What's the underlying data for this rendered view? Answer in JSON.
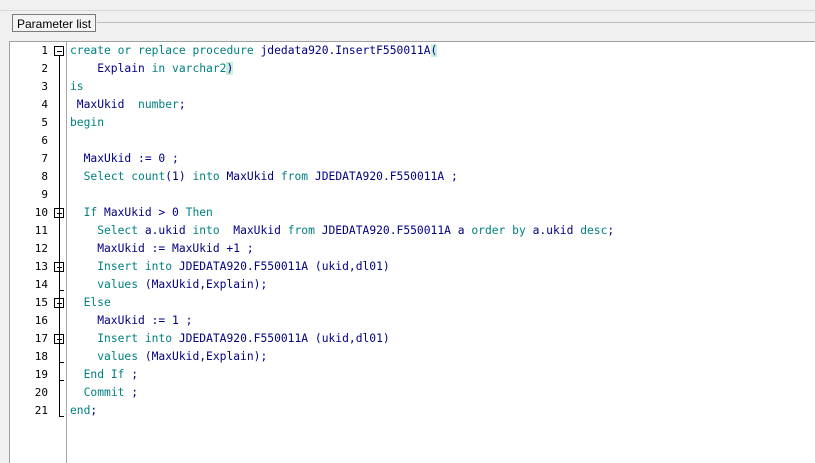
{
  "toolbar": {
    "parameter_list_label": "Parameter list"
  },
  "colors": {
    "keyword": "#008080",
    "identifier": "#000080",
    "background": "#ffffff",
    "gutter_border": "#a8a8a8"
  },
  "editor": {
    "lines": [
      {
        "number": "1",
        "text": "create or replace procedure jdedata920.InsertF550011A("
      },
      {
        "number": "2",
        "text": "    Explain in varchar2)"
      },
      {
        "number": "3",
        "text": "is"
      },
      {
        "number": "4",
        "text": " MaxUkid  number;"
      },
      {
        "number": "5",
        "text": "begin"
      },
      {
        "number": "6",
        "text": ""
      },
      {
        "number": "7",
        "text": "  MaxUkid := 0 ;"
      },
      {
        "number": "8",
        "text": "  Select count(1) into MaxUkid from JDEDATA920.F550011A ;"
      },
      {
        "number": "9",
        "text": ""
      },
      {
        "number": "10",
        "text": "  If MaxUkid > 0 Then"
      },
      {
        "number": "11",
        "text": "    Select a.ukid into  MaxUkid from JDEDATA920.F550011A a order by a.ukid desc;"
      },
      {
        "number": "12",
        "text": "    MaxUkid := MaxUkid +1 ;"
      },
      {
        "number": "13",
        "text": "    Insert into JDEDATA920.F550011A (ukid,dl01)"
      },
      {
        "number": "14",
        "text": "    values (MaxUkid,Explain);"
      },
      {
        "number": "15",
        "text": "  Else"
      },
      {
        "number": "16",
        "text": "    MaxUkid := 1 ;"
      },
      {
        "number": "17",
        "text": "    Insert into JDEDATA920.F550011A (ukid,dl01)"
      },
      {
        "number": "18",
        "text": "    values (MaxUkid,Explain);"
      },
      {
        "number": "19",
        "text": "  End If ;"
      },
      {
        "number": "20",
        "text": "  Commit ;"
      },
      {
        "number": "21",
        "text": "end;"
      }
    ]
  }
}
